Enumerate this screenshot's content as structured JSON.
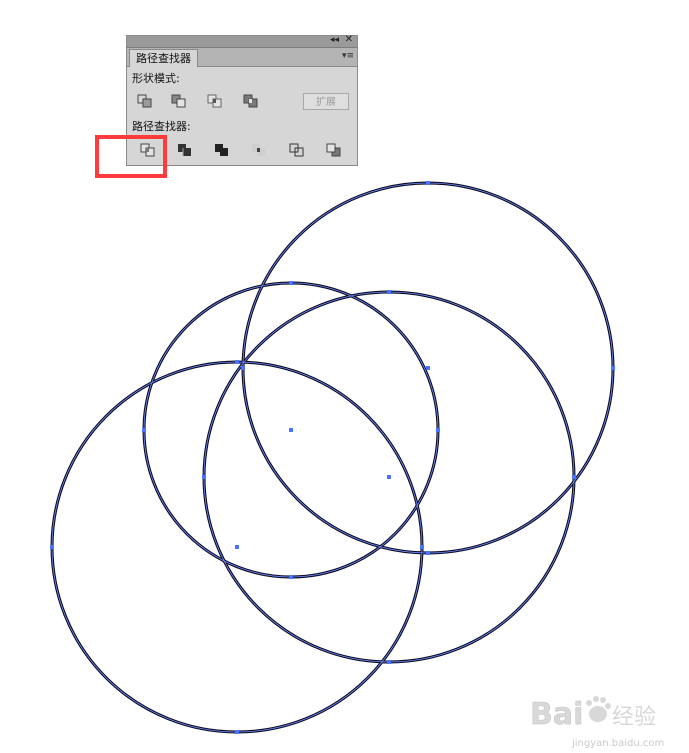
{
  "panel": {
    "tab_label": "路径查找器",
    "collapse_glyph": "◂◂",
    "close_glyph": "✕",
    "menu_glyph": "▾≡",
    "shape_modes_label": "形状模式:",
    "shape_mode_icons": [
      "unite-icon",
      "minus-front-icon",
      "intersect-icon",
      "exclude-icon"
    ],
    "expand_label": "扩展",
    "pathfinders_label": "路径查找器:",
    "pathfinder_icons": [
      "divide-icon",
      "trim-icon",
      "merge-icon",
      "crop-icon",
      "outline-icon",
      "minus-back-icon"
    ]
  },
  "highlight": {
    "target": "divide-icon",
    "color": "#ff3b3b"
  },
  "canvas": {
    "shapes": [
      "circle-top-right",
      "circle-middle-left",
      "circle-middle-right",
      "circle-bottom-left"
    ],
    "stroke_color": "#0d0d22",
    "anchor_color": "#4a74ff"
  },
  "watermark": {
    "text": "Baidu经验",
    "subtext": "jingyan.baidu.com"
  }
}
